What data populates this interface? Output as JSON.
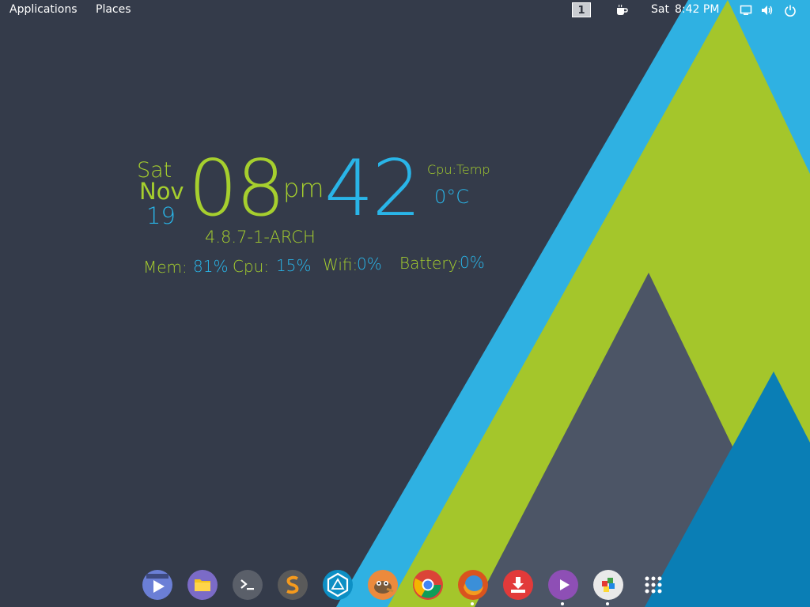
{
  "topbar": {
    "applications_label": "Applications",
    "places_label": "Places",
    "workspace_number": "1",
    "clock_day": "Sat",
    "clock_time": "8:42 PM",
    "icons": [
      "coffee-icon",
      "screen-icon",
      "volume-icon",
      "power-icon"
    ]
  },
  "conky": {
    "day": "Sat",
    "month": "Nov",
    "date": "19",
    "hour": "08",
    "ampm": "pm",
    "minute": "42",
    "cpu_temp_label": "Cpu:Temp",
    "cpu_temp_value": "0°C",
    "kernel": "4.8.7-1-ARCH",
    "mem_label": "Mem:",
    "mem_value": "81%",
    "cpu_label": "Cpu:",
    "cpu_value": "15%",
    "wifi_label": "Wifi:",
    "wifi_value": "0%",
    "battery_label": "Battery:",
    "battery_value": "0%"
  },
  "dock": {
    "items": [
      "video-player-icon",
      "files-icon",
      "terminal-icon",
      "sublime-text-icon",
      "ingress-icon",
      "gimp-icon",
      "chrome-icon",
      "firefox-icon",
      "downloader-icon",
      "media-player-icon",
      "software-center-icon",
      "app-grid-icon"
    ]
  },
  "colors": {
    "background": "#343b4a",
    "lime": "#a6cf2e",
    "cyan": "#29b5e8",
    "slate": "#4c5566",
    "deep_blue": "#0a7eb5"
  }
}
